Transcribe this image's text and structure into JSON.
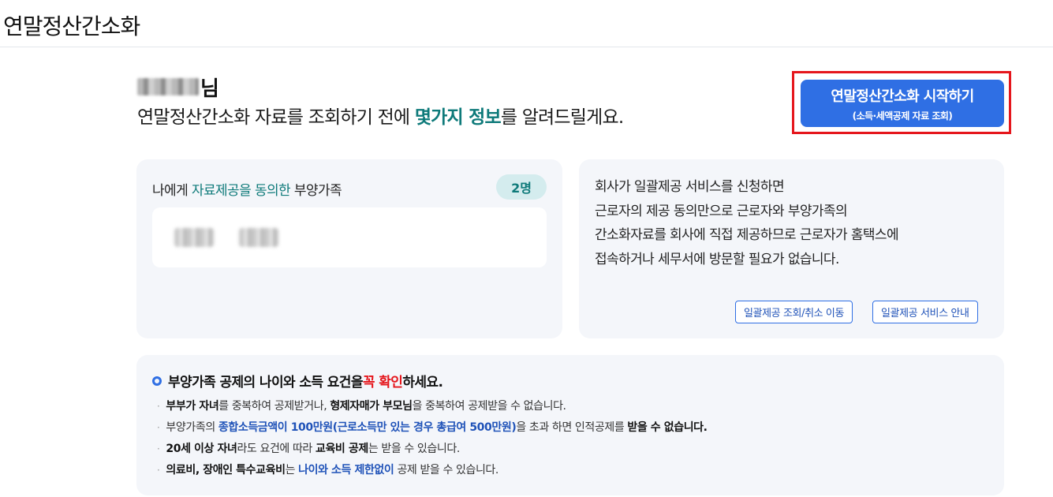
{
  "header": {
    "title": "연말정산간소화"
  },
  "greeting": {
    "name_suffix": "님",
    "intro_pre": "연말정산간소화 자료를 조회하기 전에 ",
    "intro_highlight": "몇가지 정보",
    "intro_post": "를 알려드릴게요."
  },
  "start_button": {
    "label": "연말정산간소화 시작하기",
    "sublabel": "(소득·세액공제 자료 조회)"
  },
  "dependents": {
    "title_pre": "나에게 ",
    "title_highlight": "자료제공을 동의한",
    "title_post": " 부양가족",
    "count": "2명"
  },
  "service": {
    "lines": [
      "회사가 일괄제공 서비스를 신청하면",
      "근로자의 제공 동의만으로 근로자와 부양가족의",
      "간소화자료를 회사에 직접 제공하므로 근로자가 홈택스에",
      "접속하거나 세무서에 방문할 필요가 없습니다."
    ],
    "button_lookup": "일괄제공 조회/취소 이동",
    "button_info": "일괄제공 서비스 안내"
  },
  "notice": {
    "title_pre": "부양가족 공제의 나이와 소득 요건을 ",
    "title_red": "꼭 확인",
    "title_post": "하세요.",
    "item1": {
      "b1": "부부가 자녀",
      "t1": "를 중복하여 공제받거나, ",
      "b2": "형제자매가 부모님",
      "t2": "을 중복하여 공제받을 수 없습니다."
    },
    "item2": {
      "t1": "부양가족의 ",
      "blue": "종합소득금액이 100만원(근로소득만 있는 경우 총급여 500만원)",
      "t2": "을 초과 하면 인적공제를 ",
      "b": "받을 수 없습니다."
    },
    "item3": {
      "b1": "20세 이상 자녀",
      "t1": "라도 요건에 따라 ",
      "b2": "교육비 공제",
      "t2": "는 받을 수 있습니다."
    },
    "item4": {
      "b1": "의료비, 장애인 특수교육비",
      "t1": "는 ",
      "blue": "나이와 소득 제한없이",
      "t2": " 공제 받을 수 있습니다."
    }
  }
}
